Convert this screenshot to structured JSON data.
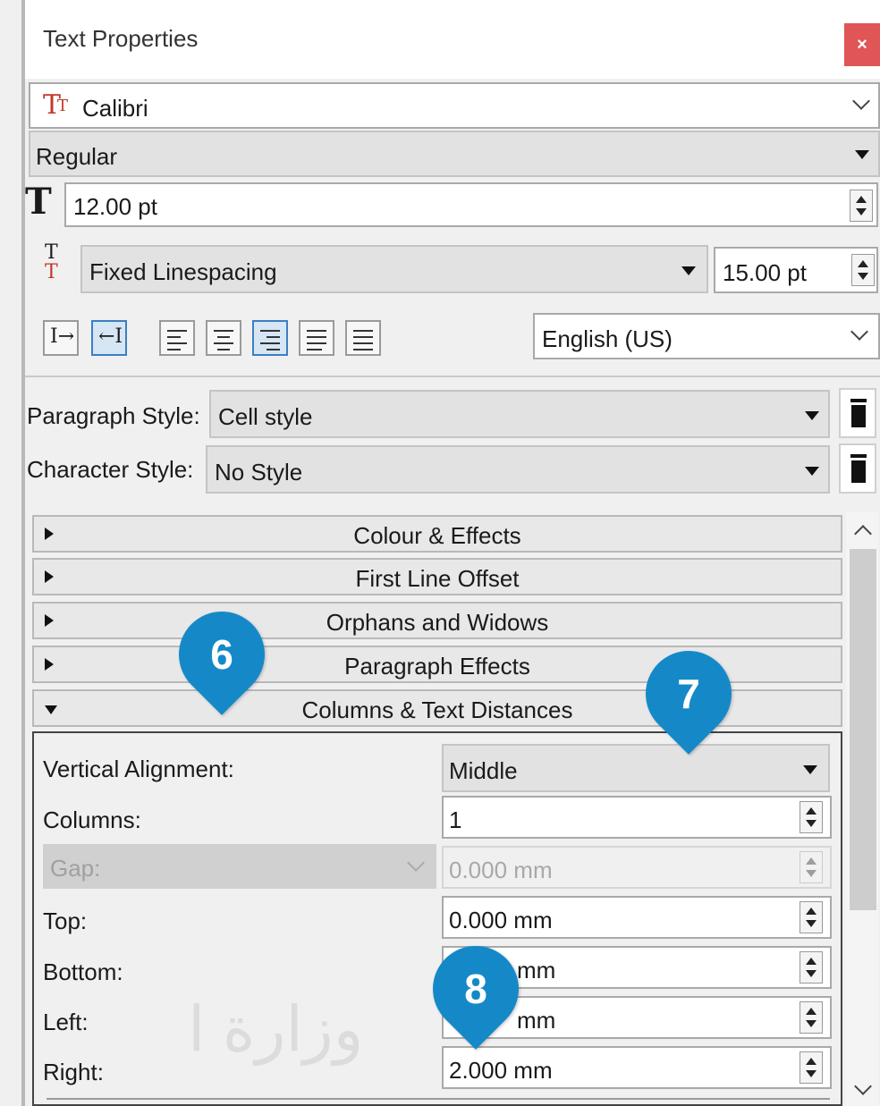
{
  "title": "Text Properties",
  "close_label": "×",
  "font": {
    "family": "Calibri",
    "icon": "font-icon",
    "icon_glyph": "T"
  },
  "style": {
    "value": "Regular"
  },
  "size": {
    "value": "12.00 pt"
  },
  "linespacing": {
    "mode": "Fixed Linespacing",
    "value": "15.00 pt"
  },
  "language": {
    "value": "English (US)"
  },
  "paragraph_style": {
    "label": "Paragraph Style:",
    "value": "Cell style"
  },
  "character_style": {
    "label": "Character Style:",
    "value": "No Style"
  },
  "sections": [
    {
      "label": "Colour & Effects",
      "open": false
    },
    {
      "label": "First Line Offset",
      "open": false
    },
    {
      "label": "Orphans and Widows",
      "open": false
    },
    {
      "label": "Paragraph Effects",
      "open": false
    },
    {
      "label": "Columns & Text Distances",
      "open": true
    }
  ],
  "columns_section": {
    "vertical_alignment": {
      "label": "Vertical Alignment:",
      "value": "Middle"
    },
    "columns": {
      "label": "Columns:",
      "value": "1"
    },
    "gap": {
      "label": "Gap:",
      "value": "0.000 mm",
      "disabled": true
    },
    "top": {
      "label": "Top:",
      "value": "0.000 mm"
    },
    "bottom": {
      "label": "Bottom:",
      "value_visible": "mm"
    },
    "left": {
      "label": "Left:",
      "value_visible": "mm"
    },
    "right": {
      "label": "Right:",
      "value": "2.000 mm"
    }
  },
  "markers": [
    "6",
    "7",
    "8"
  ],
  "watermark_text": "وزارة ا",
  "colors": {
    "accent_marker": "#1589c8",
    "close": "#e05555",
    "active_button": "#3d7fc1"
  }
}
